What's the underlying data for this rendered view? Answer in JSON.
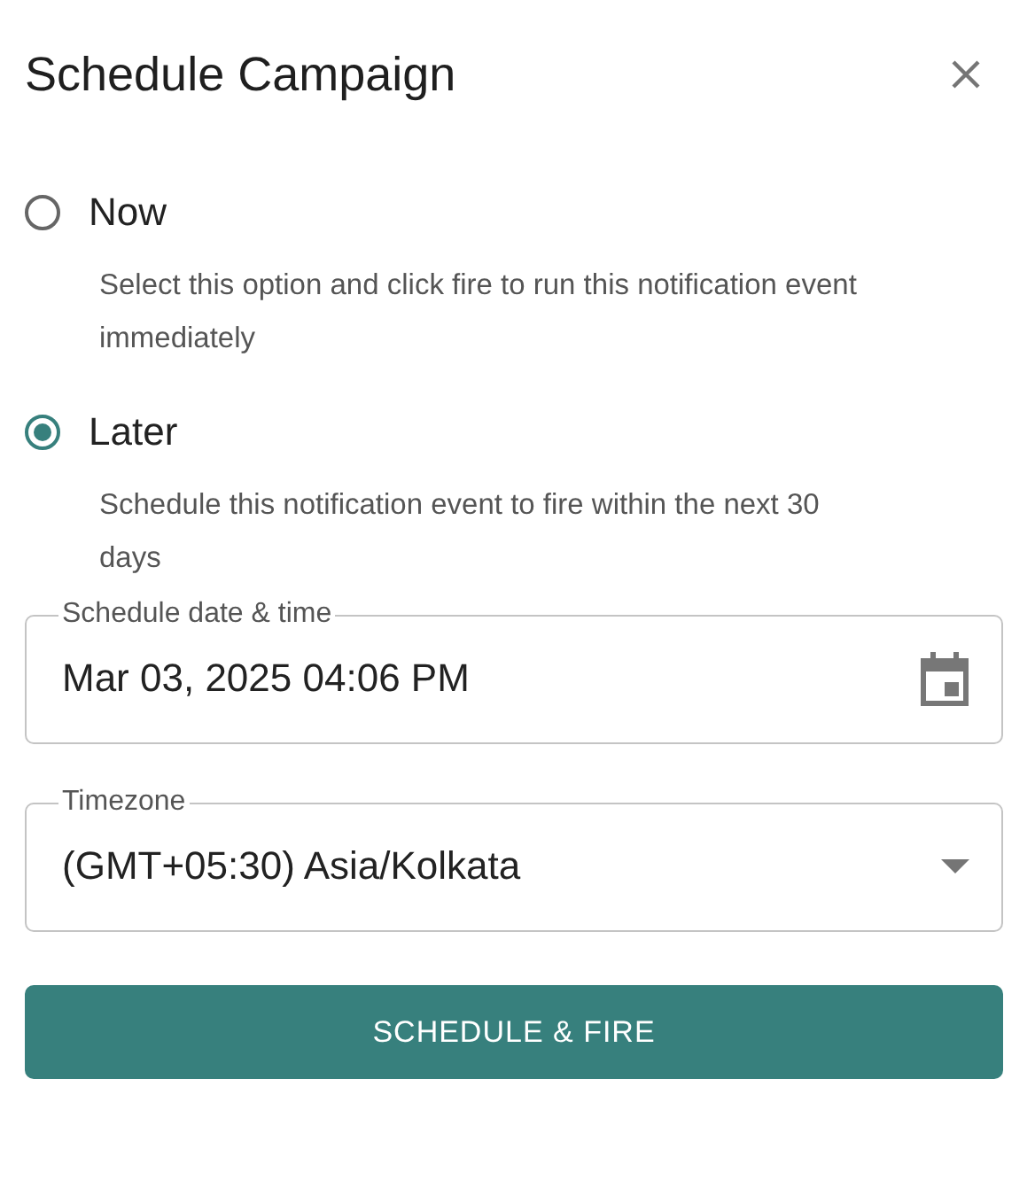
{
  "dialog": {
    "title": "Schedule Campaign"
  },
  "options": [
    {
      "label": "Now",
      "description": "Select this option and click fire to run this notification event immediately",
      "selected": false
    },
    {
      "label": "Later",
      "description": "Schedule this notification event to fire within the next 30 days",
      "selected": true
    }
  ],
  "date_field": {
    "label": "Schedule date & time",
    "value": "Mar 03, 2025 04:06 PM"
  },
  "timezone_field": {
    "label": "Timezone",
    "value": "(GMT+05:30) Asia/Kolkata"
  },
  "button": {
    "label": "SCHEDULE & FIRE"
  }
}
